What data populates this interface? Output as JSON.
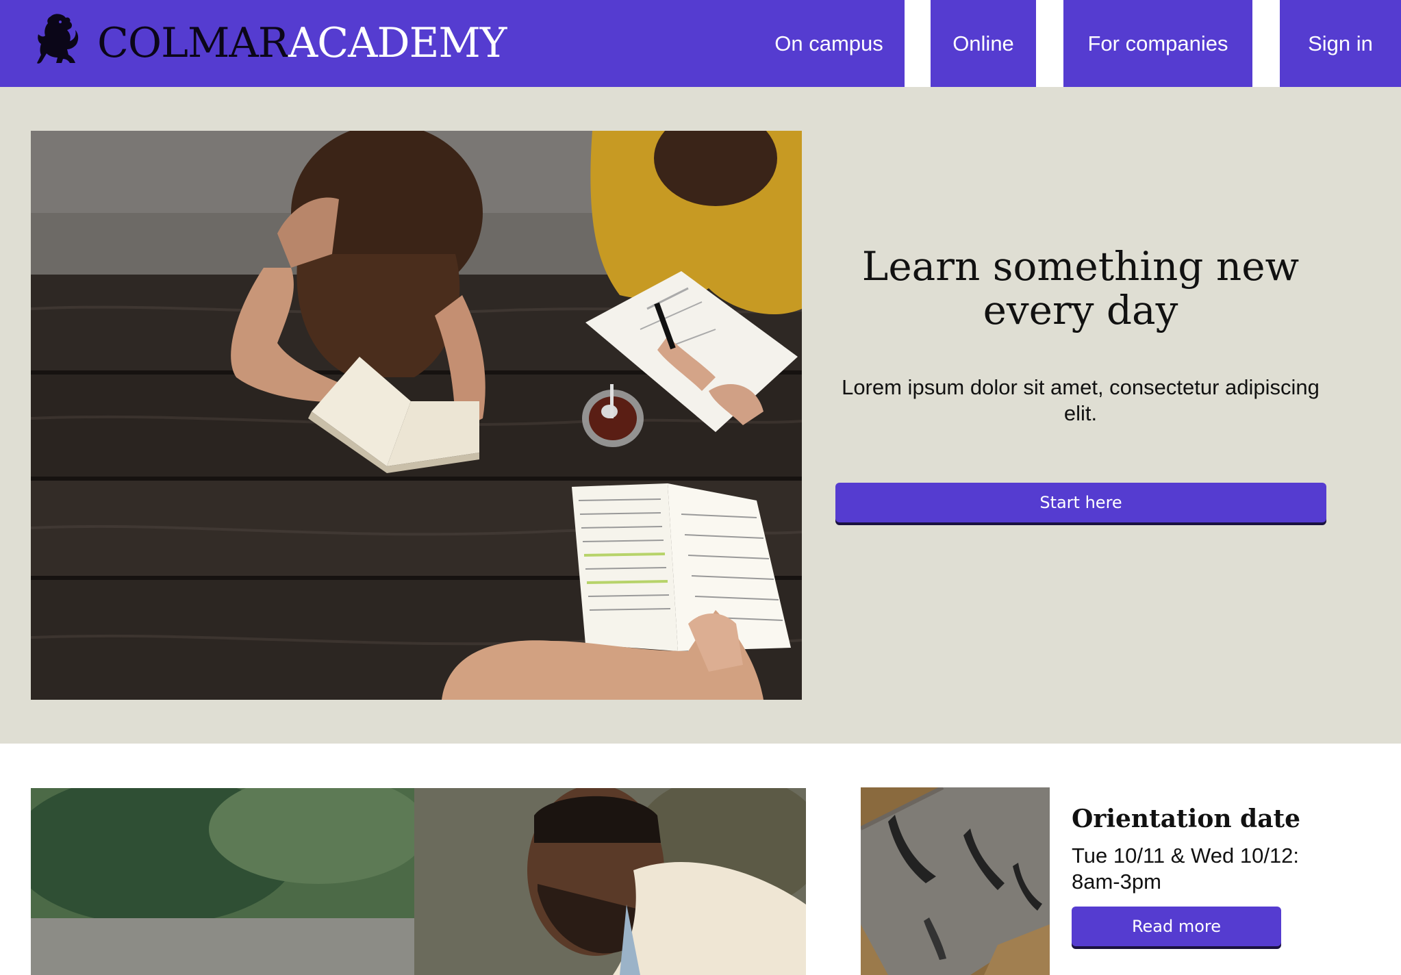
{
  "header": {
    "logo_part1": "COLMAR",
    "logo_part2": "ACADEMY",
    "logo_icon": "lion-crest-icon",
    "nav": {
      "on_campus": "On campus",
      "online": "Online",
      "for_companies": "For companies",
      "sign_in": "Sign in"
    }
  },
  "hero": {
    "photo": "students-studying-at-picnic-table-photo",
    "title": "Learn something new every day",
    "description": "Lorem ipsum dolor sit amet, consectetur adipiscing elit.",
    "button_label": "Start here"
  },
  "lower": {
    "photo": "smiling-man-outdoors-photo",
    "card": {
      "thumbnail": "aerial-shadows-photo",
      "title": "Orientation date",
      "text": "Tue 10/11 & Wed 10/12: 8am-3pm",
      "button_label": "Read more"
    }
  },
  "colors": {
    "brand_purple": "#553cd0",
    "hero_background": "#dfded3",
    "text_dark": "#111111"
  }
}
